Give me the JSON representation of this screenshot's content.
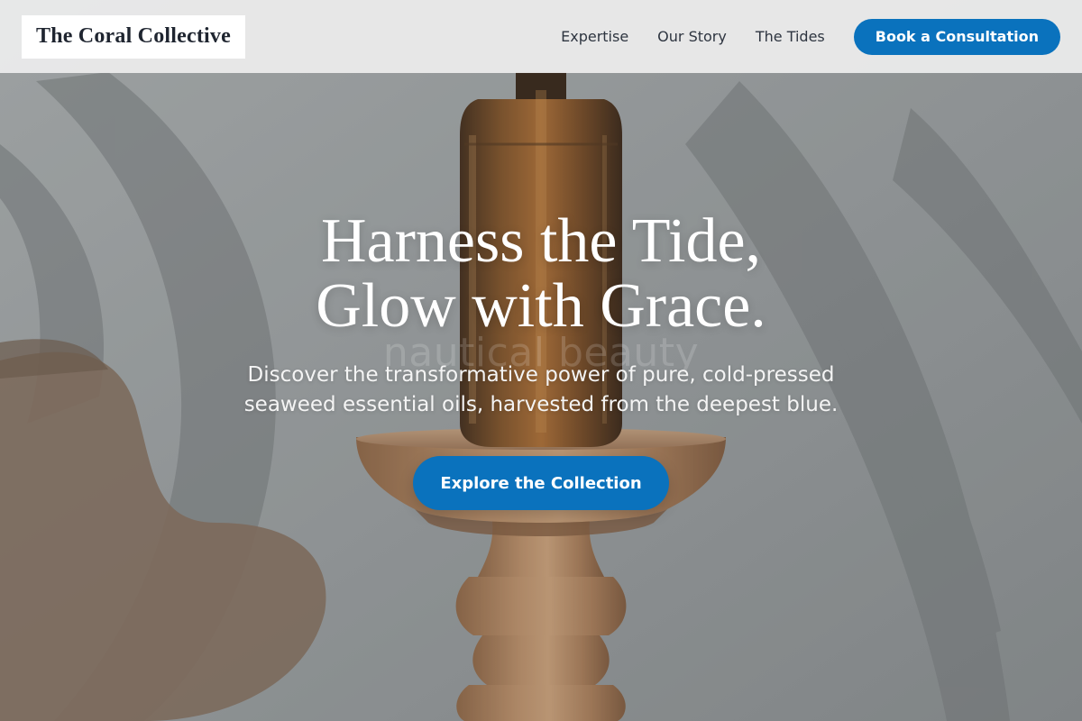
{
  "header": {
    "logo": "The Coral Collective",
    "nav": [
      {
        "label": "Expertise"
      },
      {
        "label": "Our Story"
      },
      {
        "label": "The Tides"
      }
    ],
    "cta_label": "Book a Consultation"
  },
  "hero": {
    "title_line1": "Harness the Tide,",
    "title_line2": "Glow with Grace.",
    "watermark": "nautical beauty",
    "subtitle": "Discover the transformative power of pure, cold-pressed seaweed essential oils, harvested from the deepest blue.",
    "button_label": "Explore the Collection",
    "background_image": "amber dropper bottle on a wooden pedestal with leaf shadows"
  },
  "colors": {
    "accent": "#0a72bd",
    "header_bg": "#ececec",
    "hero_bg": "#8f9394",
    "title_text": "#ffffff"
  }
}
